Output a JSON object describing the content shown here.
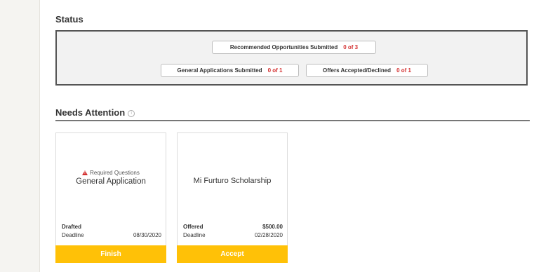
{
  "status": {
    "heading": "Status",
    "recommended": {
      "label": "Recommended Opportunities Submitted",
      "count": "0 of 3"
    },
    "general": {
      "label": "General Applications Submitted",
      "count": "0 of 1"
    },
    "offers": {
      "label": "Offers Accepted/Declined",
      "count": "0 of 1"
    }
  },
  "needs_attention": {
    "heading": "Needs Attention",
    "info_icon": "info-icon",
    "cards": [
      {
        "notice": "Required Questions",
        "notice_icon": "warning-icon",
        "title": "General Application",
        "status": "Drafted",
        "status_value": "",
        "deadline_label": "Deadline",
        "deadline": "08/30/2020",
        "action": "Finish"
      },
      {
        "title": "Mi Furturo Scholarship",
        "status": "Offered",
        "status_value": "$500.00",
        "deadline_label": "Deadline",
        "deadline": "02/28/2020",
        "action": "Accept"
      }
    ]
  },
  "colors": {
    "accent_button": "#ffc107",
    "count_red": "#d32f2f",
    "status_box_bg": "#f2f2f2"
  }
}
